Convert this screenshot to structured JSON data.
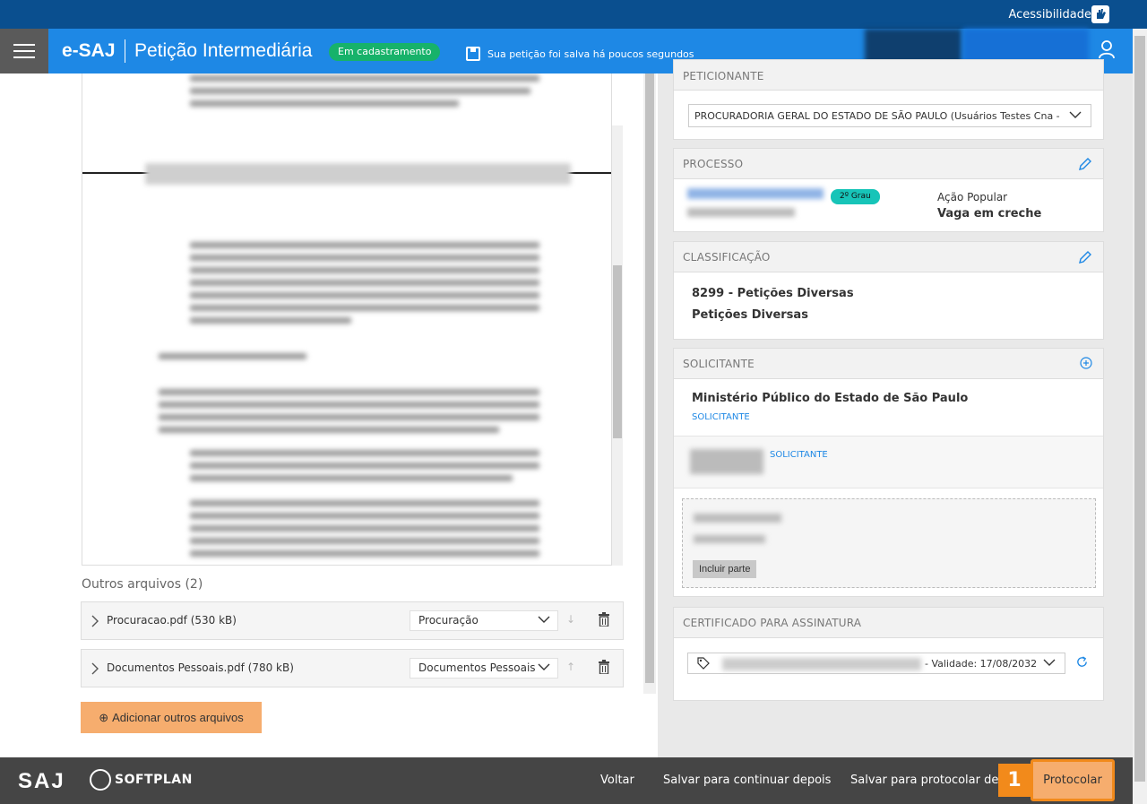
{
  "accessibility": {
    "label": "Acessibilidade"
  },
  "header": {
    "app_name": "e-SAJ",
    "title": "Petição Intermediária",
    "status_badge": "Em cadastramento",
    "save_status": "Sua petição foi salva há poucos segundos"
  },
  "other_files": {
    "title": "Outros arquivos (2)",
    "items": [
      {
        "name": "Procuracao.pdf (530 kB)",
        "type": "Procuração"
      },
      {
        "name": "Documentos Pessoais.pdf (780 kB)",
        "type": "Documentos Pessoais"
      }
    ],
    "add_button": "Adicionar outros arquivos"
  },
  "peticionante": {
    "title": "PETICIONANTE",
    "selected": "PROCURADORIA GERAL DO ESTADO DE SÃO PAULO (Usuários Testes Cna - Pro"
  },
  "processo": {
    "title": "PROCESSO",
    "grau": "2º Grau",
    "classe": "Ação Popular",
    "assunto": "Vaga em creche"
  },
  "classificacao": {
    "title": "CLASSIFICAÇÃO",
    "codigo": "8299 - Petições Diversas",
    "nome": "Petições Diversas"
  },
  "solicitante": {
    "title": "SOLICITANTE",
    "parte_1_nome": "Ministério Público do Estado de São Paulo",
    "parte_1_tipo": "SOLICITANTE",
    "parte_2_tipo": "SOLICITANTE",
    "incluir_parte": "Incluir parte"
  },
  "certificado": {
    "title": "CERTIFICADO PARA ASSINATURA",
    "validade": "- Validade: 17/08/2032"
  },
  "footer": {
    "saj_logo": "SAJ",
    "softplan_logo": "SOFTPLAN",
    "voltar": "Voltar",
    "salvar_continuar": "Salvar para continuar depois",
    "salvar_protocolar": "Salvar para protocolar dep",
    "step_number": "1",
    "protocolar": "Protocolar"
  },
  "colors": {
    "header_blue": "#1e88e5",
    "top_bar": "#0a4f8f",
    "badge_green": "#17b26a",
    "accent_orange": "#f28a1b",
    "button_orange": "#f6ad6e",
    "footer_gray": "#454545"
  }
}
